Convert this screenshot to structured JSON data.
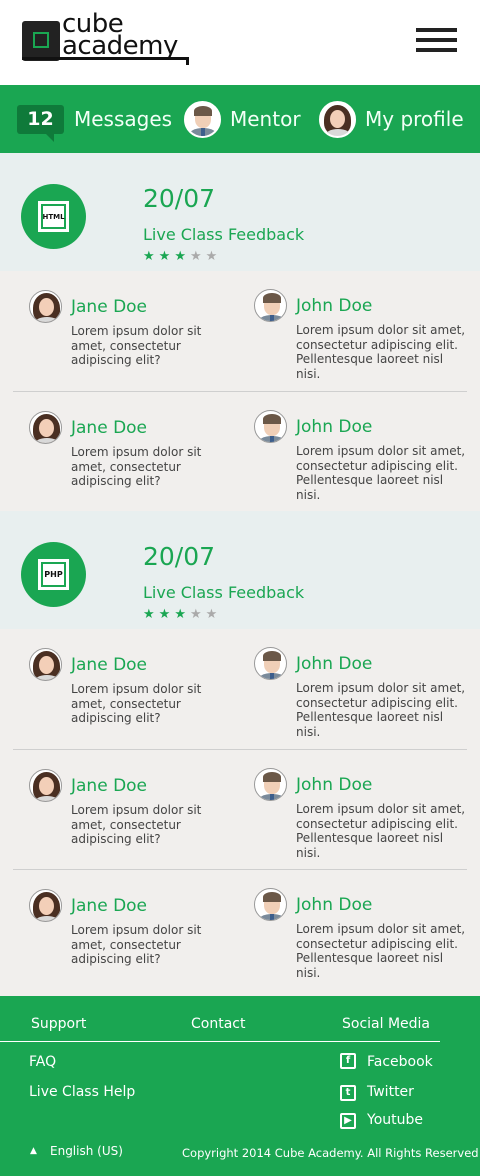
{
  "brand": {
    "line1": "cube",
    "line2": "academy"
  },
  "nav": {
    "messages_count": "12",
    "messages_label": "Messages",
    "mentor_label": "Mentor",
    "profile_label": "My profile"
  },
  "sections": [
    {
      "icon_label": "HTML",
      "date": "20/07",
      "title": "Live Class Feedback",
      "rating": 3,
      "max_rating": 5,
      "rows": [
        {
          "left": {
            "name": "Jane Doe",
            "text": [
              "Lorem ipsum dolor sit",
              "amet, consectetur",
              "adipiscing elit?"
            ]
          },
          "right": {
            "name": "John Doe",
            "text": [
              "Lorem ipsum dolor sit amet,",
              "consectetur adipiscing elit.",
              "Pellentesque laoreet nisl nisi."
            ]
          }
        },
        {
          "left": {
            "name": "Jane Doe",
            "text": [
              "Lorem ipsum dolor sit",
              "amet, consectetur",
              "adipiscing elit?"
            ]
          },
          "right": {
            "name": "John Doe",
            "text": [
              "Lorem ipsum dolor sit amet,",
              "consectetur adipiscing elit.",
              "Pellentesque laoreet nisl nisi."
            ]
          }
        }
      ]
    },
    {
      "icon_label": "PHP",
      "date": "20/07",
      "title": "Live Class Feedback",
      "rating": 3,
      "max_rating": 5,
      "rows": [
        {
          "left": {
            "name": "Jane Doe",
            "text": [
              "Lorem ipsum dolor sit",
              "amet, consectetur",
              "adipiscing elit?"
            ]
          },
          "right": {
            "name": "John Doe",
            "text": [
              "Lorem ipsum dolor sit amet,",
              "consectetur adipiscing elit.",
              "Pellentesque laoreet nisl nisi."
            ]
          }
        },
        {
          "left": {
            "name": "Jane Doe",
            "text": [
              "Lorem ipsum dolor sit",
              "amet, consectetur",
              "adipiscing elit?"
            ]
          },
          "right": {
            "name": "John Doe",
            "text": [
              "Lorem ipsum dolor sit amet,",
              "consectetur adipiscing elit.",
              "Pellentesque laoreet nisl nisi."
            ]
          }
        },
        {
          "left": {
            "name": "Jane Doe",
            "text": [
              "Lorem ipsum dolor sit",
              "amet, consectetur",
              "adipiscing elit?"
            ]
          },
          "right": {
            "name": "John Doe",
            "text": [
              "Lorem ipsum dolor sit amet,",
              "consectetur adipiscing elit.",
              "Pellentesque laoreet nisl nisi."
            ]
          }
        }
      ]
    }
  ],
  "footer": {
    "support": "Support",
    "contact": "Contact",
    "social": "Social Media",
    "faq": "FAQ",
    "help": "Live Class Help",
    "facebook": "Facebook",
    "twitter": "Twitter",
    "youtube": "Youtube",
    "language": "English (US)",
    "copyright": "Copyright 2014 Cube Academy. All Rights Reserved"
  },
  "colors": {
    "accent": "#1aa652",
    "badge": "#0f7a3a",
    "section_bg": "#e8efef",
    "body_bg": "#f1efed"
  }
}
